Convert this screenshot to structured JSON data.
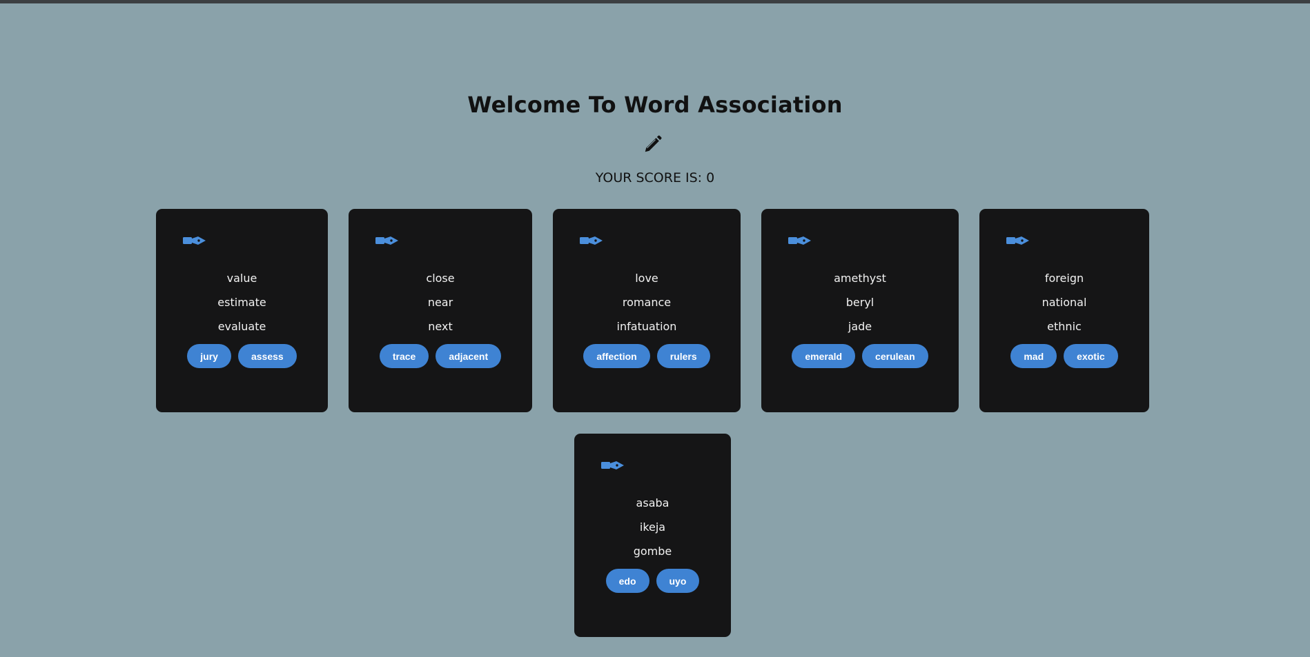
{
  "page": {
    "title": "Welcome To Word Association",
    "score_label": "YOUR SCORE IS: 0",
    "header_icon": "pencil-icon",
    "card_icon": "pen-nib-icon"
  },
  "colors": {
    "background": "#8aa2aa",
    "card": "#151516",
    "button": "#3f83d3",
    "icon": "#4b8fdc"
  },
  "cards": [
    {
      "words": [
        "value",
        "estimate",
        "evaluate"
      ],
      "options": [
        "jury",
        "assess"
      ]
    },
    {
      "words": [
        "close",
        "near",
        "next"
      ],
      "options": [
        "trace",
        "adjacent"
      ]
    },
    {
      "words": [
        "love",
        "romance",
        "infatuation"
      ],
      "options": [
        "affection",
        "rulers"
      ]
    },
    {
      "words": [
        "amethyst",
        "beryl",
        "jade"
      ],
      "options": [
        "emerald",
        "cerulean"
      ]
    },
    {
      "words": [
        "foreign",
        "national",
        "ethnic"
      ],
      "options": [
        "mad",
        "exotic"
      ]
    },
    {
      "words": [
        "asaba",
        "ikeja",
        "gombe"
      ],
      "options": [
        "edo",
        "uyo"
      ]
    }
  ]
}
